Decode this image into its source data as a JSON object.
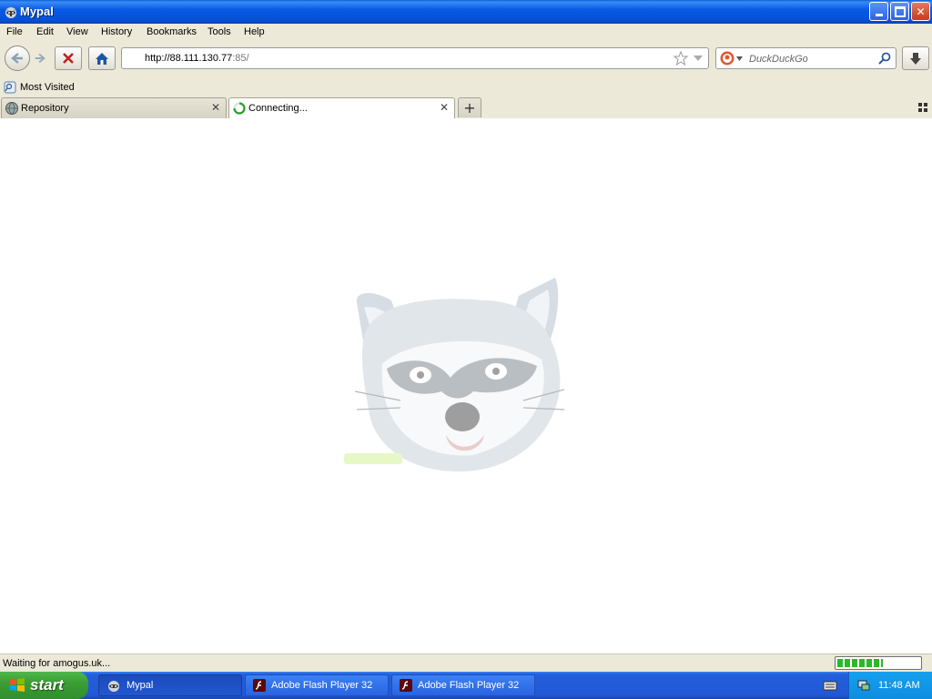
{
  "window": {
    "title": "Mypal"
  },
  "menu": [
    "File",
    "Edit",
    "View",
    "History",
    "Bookmarks",
    "Tools",
    "Help"
  ],
  "navigation": {
    "url_host": "http://88.111.130.77",
    "url_port": ":85/",
    "search_placeholder": "DuckDuckGo"
  },
  "bookmarks": {
    "most_visited": "Most Visited"
  },
  "tabs": [
    {
      "title": "Repository",
      "active": false
    },
    {
      "title": "Connecting...",
      "active": true
    }
  ],
  "status": {
    "text": "Waiting for amogus.uk...",
    "progress": 0.55
  },
  "taskbar": {
    "start_label": "start",
    "tasks": [
      {
        "label": "Mypal",
        "active": true
      },
      {
        "label": "Adobe Flash Player 32",
        "active": false
      },
      {
        "label": "Adobe Flash Player 32",
        "active": false
      }
    ],
    "clock": "11:48 AM"
  },
  "colors": {
    "titlebar": "#0a5ae6",
    "taskbar": "#245edb",
    "start": "#3a9e35",
    "progress": "#2bb82b"
  }
}
